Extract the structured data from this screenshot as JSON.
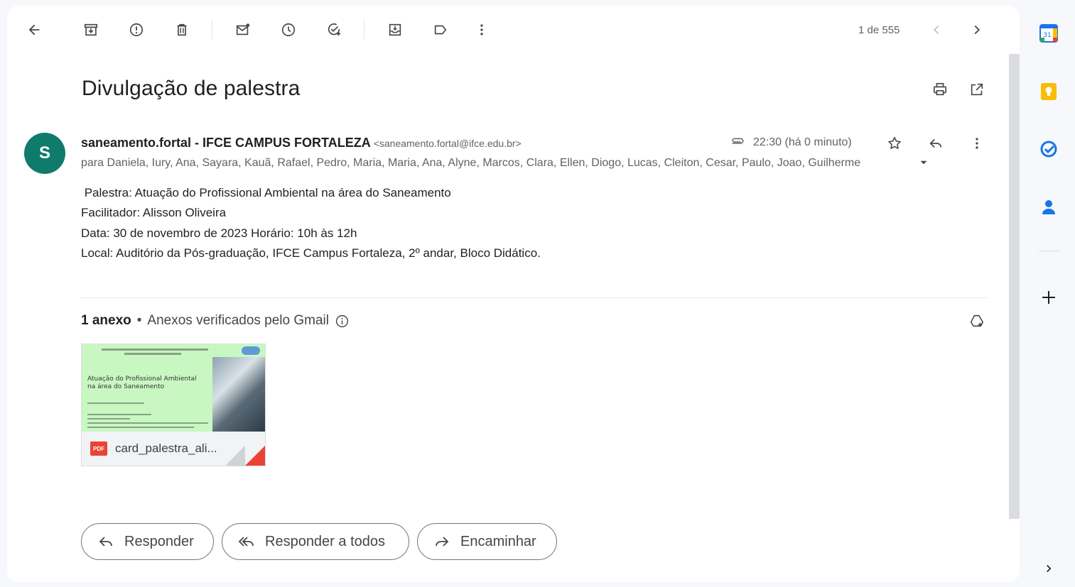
{
  "toolbar": {
    "page_count": "1 de 555"
  },
  "email": {
    "subject": "Divulgação de palestra",
    "sender_initial": "S",
    "sender_name": "saneamento.fortal - IFCE CAMPUS FORTALEZA",
    "sender_email": "<saneamento.fortal@ifce.edu.br>",
    "timestamp": "22:30 (há 0 minuto)",
    "recipients": "para Daniela, Iury, Ana, Sayara, Kauã, Rafael, Pedro, Maria, Maria, Ana, Alyne, Marcos, Clara, Ellen, Diogo, Lucas, Cleiton, Cesar, Paulo, Joao, Guilherme",
    "body_lines": [
      " Palestra: Atuação do Profissional Ambiental na área do Saneamento",
      "Facilitador: Alisson Oliveira",
      "Data: 30 de novembro de 2023 Horário: 10h às 12h",
      "Local: Auditório da Pós-graduação, IFCE Campus Fortaleza, 2º andar, Bloco Didático."
    ]
  },
  "attachments": {
    "count_label": "1 anexo",
    "bullet": "•",
    "verified_label": "Anexos verificados pelo Gmail",
    "file_badge": "PDF",
    "filename": "card_palestra_ali...",
    "thumb_text": "Atuação do Profissional Ambiental na área do Saneamento"
  },
  "actions": {
    "reply": "Responder",
    "reply_all": "Responder a todos",
    "forward": "Encaminhar"
  },
  "side_panel": {
    "calendar_day": "31"
  },
  "colors": {
    "avatar": "#0f7b6c",
    "pdf_red": "#ea4335",
    "thumb_green": "#c9f7c2",
    "keep_yellow": "#fbbc04",
    "tasks_blue": "#1a73e8",
    "contacts_blue": "#1a73e8"
  }
}
